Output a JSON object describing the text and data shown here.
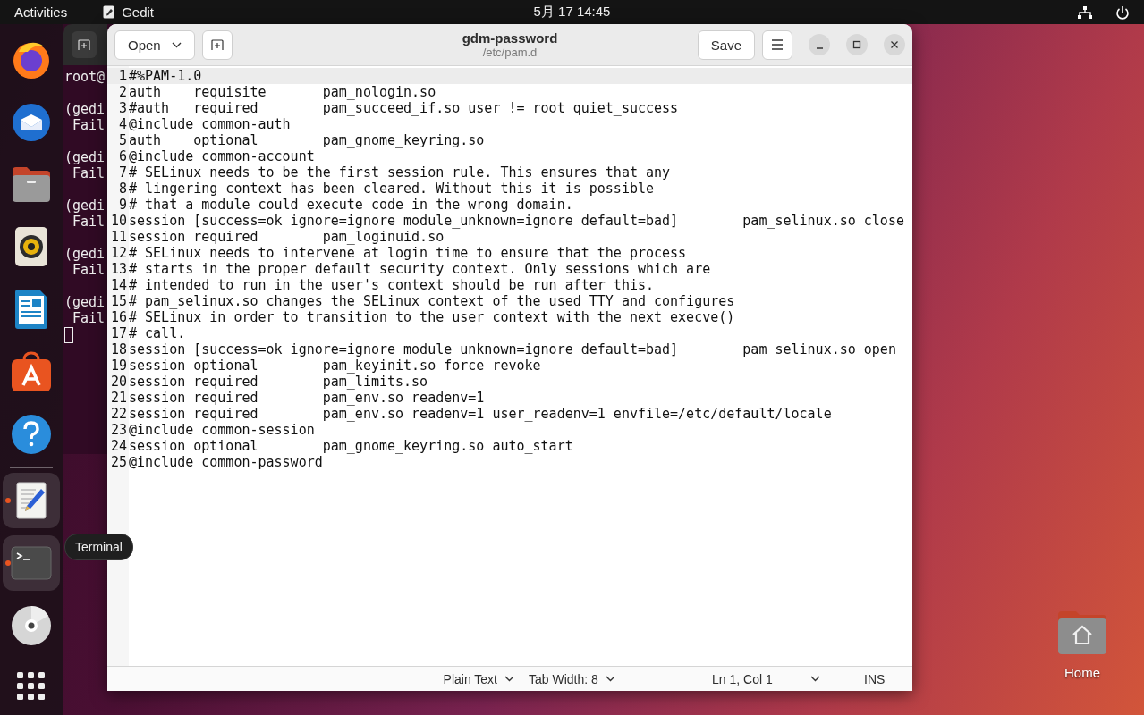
{
  "top_bar": {
    "activities": "Activities",
    "app_name": "Gedit",
    "clock": "5月 17  14:45"
  },
  "dock": {
    "items": [
      {
        "kind": "firefox",
        "running": false
      },
      {
        "kind": "thunderbird",
        "running": false
      },
      {
        "kind": "files",
        "running": false
      },
      {
        "kind": "rhythmbox",
        "running": false
      },
      {
        "kind": "writer",
        "running": false
      },
      {
        "kind": "appcenter",
        "running": false
      },
      {
        "kind": "help",
        "running": false
      },
      {
        "kind": "separator"
      },
      {
        "kind": "gedit",
        "running": true
      },
      {
        "kind": "terminal",
        "running": true
      },
      {
        "kind": "disc",
        "running": false
      }
    ],
    "tooltip": "Terminal"
  },
  "terminal_window": {
    "prompt": "root@",
    "messages": [
      {
        "source": "(gedi",
        "text": " Fail"
      },
      {
        "source": "(gedi",
        "text": " Fail"
      },
      {
        "source": "(gedi",
        "text": " Fail"
      },
      {
        "source": "(gedi",
        "text": " Fail"
      },
      {
        "source": "(gedi",
        "text": " Fail"
      }
    ]
  },
  "gedit_window": {
    "title": "gdm-password",
    "subtitle": "/etc/pam.d",
    "open_button": "Open",
    "save_button": "Save",
    "lines": [
      {
        "number": "1",
        "text": "#%PAM-1.0",
        "current": true
      },
      {
        "number": "2",
        "text": "auth    requisite       pam_nologin.so",
        "current": false
      },
      {
        "number": "3",
        "text": "#auth   required        pam_succeed_if.so user != root quiet_success",
        "current": false
      },
      {
        "number": "4",
        "text": "@include common-auth",
        "current": false
      },
      {
        "number": "5",
        "text": "auth    optional        pam_gnome_keyring.so",
        "current": false
      },
      {
        "number": "6",
        "text": "@include common-account",
        "current": false
      },
      {
        "number": "7",
        "text": "# SELinux needs to be the first session rule. This ensures that any",
        "current": false
      },
      {
        "number": "8",
        "text": "# lingering context has been cleared. Without this it is possible",
        "current": false
      },
      {
        "number": "9",
        "text": "# that a module could execute code in the wrong domain.",
        "current": false
      },
      {
        "number": "10",
        "text": "session [success=ok ignore=ignore module_unknown=ignore default=bad]        pam_selinux.so close",
        "current": false
      },
      {
        "number": "11",
        "text": "session required        pam_loginuid.so",
        "current": false
      },
      {
        "number": "12",
        "text": "# SELinux needs to intervene at login time to ensure that the process",
        "current": false
      },
      {
        "number": "13",
        "text": "# starts in the proper default security context. Only sessions which are",
        "current": false
      },
      {
        "number": "14",
        "text": "# intended to run in the user's context should be run after this.",
        "current": false
      },
      {
        "number": "15",
        "text": "# pam_selinux.so changes the SELinux context of the used TTY and configures",
        "current": false
      },
      {
        "number": "16",
        "text": "# SELinux in order to transition to the user context with the next execve()",
        "current": false
      },
      {
        "number": "17",
        "text": "# call.",
        "current": false
      },
      {
        "number": "18",
        "text": "session [success=ok ignore=ignore module_unknown=ignore default=bad]        pam_selinux.so open",
        "current": false
      },
      {
        "number": "19",
        "text": "session optional        pam_keyinit.so force revoke",
        "current": false
      },
      {
        "number": "20",
        "text": "session required        pam_limits.so",
        "current": false
      },
      {
        "number": "21",
        "text": "session required        pam_env.so readenv=1",
        "current": false
      },
      {
        "number": "22",
        "text": "session required        pam_env.so readenv=1 user_readenv=1 envfile=/etc/default/locale",
        "current": false
      },
      {
        "number": "23",
        "text": "@include common-session",
        "current": false
      },
      {
        "number": "24",
        "text": "session optional        pam_gnome_keyring.so auto_start",
        "current": false
      },
      {
        "number": "25",
        "text": "@include common-password",
        "current": false
      }
    ],
    "status_bar": {
      "language": "Plain Text",
      "tab_width": "Tab Width: 8",
      "position": "Ln 1, Col 1",
      "mode": "INS"
    }
  },
  "desktop_icons": [
    {
      "label": "Home"
    }
  ]
}
